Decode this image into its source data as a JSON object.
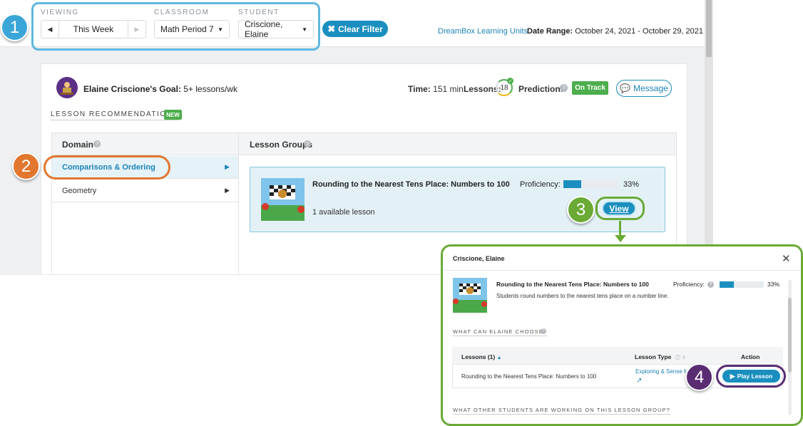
{
  "filters": {
    "viewing": {
      "label": "VIEWING",
      "value": "This Week",
      "prev_icon": "triangle-left",
      "next_icon": "triangle-right"
    },
    "classroom": {
      "label": "CLASSROOM",
      "value": "Math Period 7"
    },
    "student": {
      "label": "STUDENT",
      "value": "Criscione, Elaine"
    },
    "clear_filter": "Clear Filter",
    "units_link": "DreamBox Learning Units",
    "date_range_label": "Date Range:",
    "date_range_value": "October 24, 2021 - October 29, 2021"
  },
  "goal": {
    "name": "Elaine Criscione's Goal:",
    "value": "5+ lessons/wk",
    "time_label": "Time:",
    "time_value": "151 min",
    "lessons_label": "Lessons:",
    "lessons_value": "18",
    "prediction_label": "Prediction:",
    "prediction_status": "On Track",
    "message_button": "Message"
  },
  "recommendations": {
    "title": "LESSON RECOMMENDATIONS",
    "new_badge": "NEW",
    "domain_header": "Domain",
    "groups_header": "Lesson Groups",
    "domains": [
      {
        "label": "Comparisons & Ordering",
        "selected": true
      },
      {
        "label": "Geometry",
        "selected": false
      }
    ],
    "group": {
      "title": "Rounding to the Nearest Tens Place: Numbers to 100",
      "available": "1 available lesson",
      "proficiency_label": "Proficiency:",
      "proficiency_value": "33%",
      "proficiency_fraction": 0.33,
      "view_button": "View"
    }
  },
  "modal": {
    "student": "Criscione, Elaine",
    "title": "Rounding to the Nearest Tens Place: Numbers to 100",
    "description": "Students round numbers to the nearest tens place on a number line.",
    "proficiency_label": "Proficiency:",
    "proficiency_value": "33%",
    "proficiency_fraction": 0.33,
    "choose_header": "WHAT CAN ELAINE CHOOSE?",
    "table": {
      "col_lessons": "Lessons (1)",
      "col_type": "Lesson Type",
      "col_action": "Action",
      "row_lesson": "Rounding to the Nearest Tens Place: Numbers to 100",
      "row_type": "Exploring & Sense M",
      "row_action": "Play Lesson"
    },
    "others_header": "WHAT OTHER STUDENTS ARE WORKING ON THIS LESSON GROUP?"
  },
  "callouts": [
    "1",
    "2",
    "3",
    "4"
  ],
  "colors": {
    "accent": "#1a8fbf",
    "callout1": "#3aa6d8",
    "callout2": "#e2762e",
    "callout3": "#6aaa35",
    "callout4": "#5a2d73",
    "on_track": "#4cae4c"
  }
}
